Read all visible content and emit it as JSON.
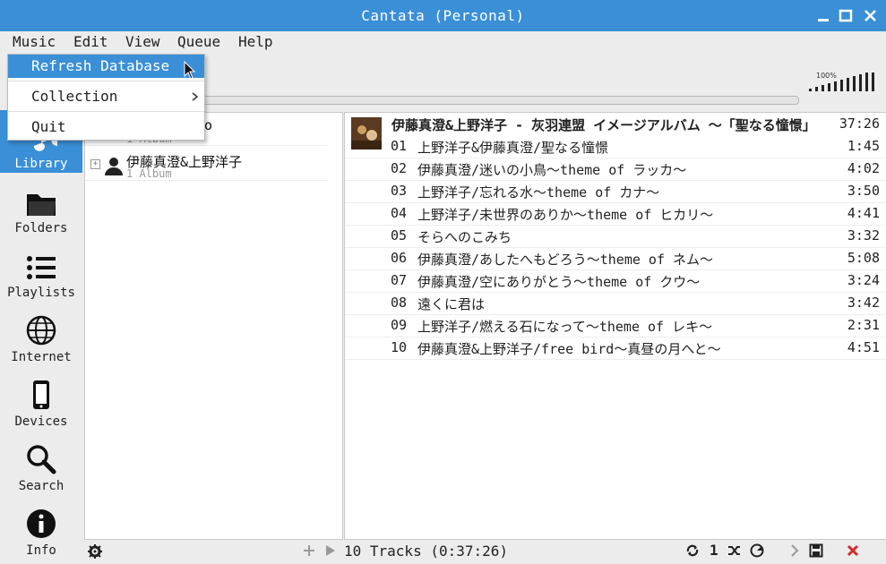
{
  "window": {
    "title": "Cantata (Personal)"
  },
  "menubar": [
    "Music",
    "Edit",
    "View",
    "Queue",
    "Help"
  ],
  "music_menu": {
    "refresh": "Refresh Database",
    "collection": "Collection",
    "quit": "Quit"
  },
  "volume": {
    "label": "100%",
    "level": 1.0
  },
  "sidebar": {
    "items": [
      {
        "label": "Library",
        "icon": "library-icon",
        "selected": true
      },
      {
        "label": "Folders",
        "icon": "folder-icon"
      },
      {
        "label": "Playlists",
        "icon": "playlist-icon"
      },
      {
        "label": "Internet",
        "icon": "globe-icon"
      },
      {
        "label": "Devices",
        "icon": "device-icon"
      },
      {
        "label": "Search",
        "icon": "search-icon"
      },
      {
        "label": "Info",
        "icon": "info-icon"
      }
    ]
  },
  "library": {
    "artists": [
      {
        "name": "ro",
        "sub": "1 Album"
      },
      {
        "name": "伊藤真澄&上野洋子",
        "sub": "1 Album"
      }
    ]
  },
  "album": {
    "title": "伊藤真澄&上野洋子 - 灰羽連盟 イメージアルバム ～「聖なる憧憬」",
    "duration": "37:26"
  },
  "tracks": [
    {
      "num": "01",
      "title": "上野洋子&伊藤真澄/聖なる憧憬",
      "dur": "1:45"
    },
    {
      "num": "02",
      "title": "伊藤真澄/迷いの小鳥～theme of ラッカ～",
      "dur": "4:02"
    },
    {
      "num": "03",
      "title": "上野洋子/忘れる水～theme of カナ～",
      "dur": "3:50"
    },
    {
      "num": "04",
      "title": "上野洋子/未世界のありか～theme of ヒカリ～",
      "dur": "4:41"
    },
    {
      "num": "05",
      "title": "そらへのこみち",
      "dur": "3:32"
    },
    {
      "num": "06",
      "title": "伊藤真澄/あしたへもどろう～theme of ネム～",
      "dur": "5:08"
    },
    {
      "num": "07",
      "title": "伊藤真澄/空にありがとう～theme of クウ～",
      "dur": "3:24"
    },
    {
      "num": "08",
      "title": "遠くに君は",
      "dur": "3:42"
    },
    {
      "num": "09",
      "title": "上野洋子/燃える石になって～theme of レキ～",
      "dur": "2:31"
    },
    {
      "num": "10",
      "title": "伊藤真澄&上野洋子/free bird～真昼の月へと～",
      "dur": "4:51"
    }
  ],
  "status": {
    "tracks": "10 Tracks (0:37:26)",
    "repeat_count": "1"
  }
}
